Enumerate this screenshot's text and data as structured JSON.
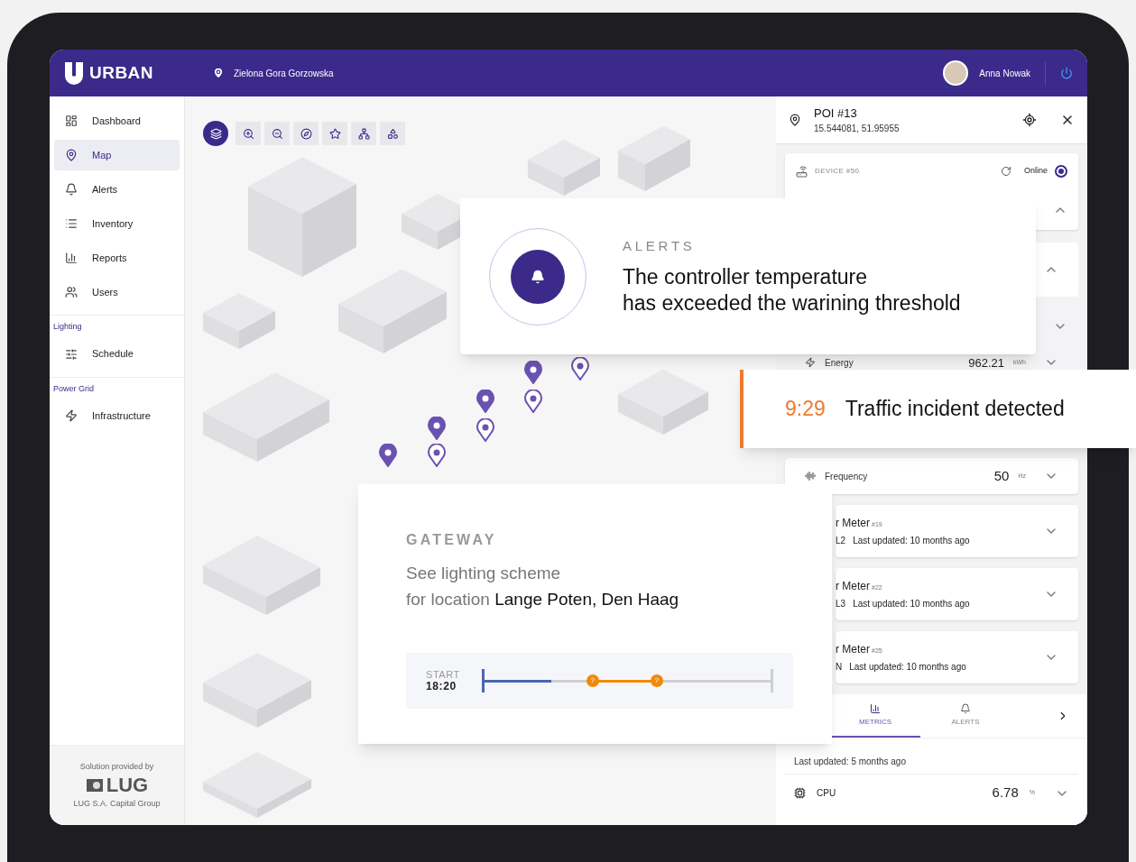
{
  "header": {
    "logo": "URBAN",
    "location": "Zielona Gora Gorzowska",
    "user": "Anna Nowak"
  },
  "sidebar": {
    "items": [
      {
        "label": "Dashboard",
        "selected": false
      },
      {
        "label": "Map",
        "selected": true
      },
      {
        "label": "Alerts",
        "selected": false
      },
      {
        "label": "Inventory",
        "selected": false
      },
      {
        "label": "Reports",
        "selected": false
      },
      {
        "label": "Users",
        "selected": false
      }
    ],
    "sections": [
      {
        "title": "Lighting",
        "items": [
          {
            "label": "Schedule",
            "selected": false
          }
        ]
      },
      {
        "title": "Power Grid",
        "items": [
          {
            "label": "Infrastructure",
            "selected": false
          }
        ]
      }
    ],
    "footer": {
      "caption": "Solution provided by",
      "logo": "LUG",
      "company": "LUG S.A. Capital Group"
    }
  },
  "map": {
    "tools": [
      {
        "selected": true
      },
      {
        "selected": false
      },
      {
        "selected": false
      },
      {
        "selected": false
      },
      {
        "selected": false
      },
      {
        "selected": false
      },
      {
        "selected": false
      }
    ]
  },
  "panel": {
    "poi": {
      "title": "POI #13",
      "coordinates": "15.544081, 51.95955"
    },
    "device": {
      "label": "DEVICE #50",
      "status": "Online",
      "online": true
    },
    "hidden_rows": [
      {
        "expanded": true
      },
      {
        "expanded": true
      },
      {
        "expanded": false
      }
    ],
    "energy": {
      "label": "Energy",
      "value": "962.21",
      "unit": "kWh",
      "expanded": false
    },
    "frequency": {
      "label": "Frequency",
      "value": "50",
      "unit": "Hz",
      "expanded": false
    },
    "meters": [
      {
        "name": "r Meter",
        "number": "#19",
        "phase": "L2",
        "updated": "Last updated: 10 months ago",
        "expanded": false
      },
      {
        "name": "r Meter",
        "number": "#22",
        "phase": "L3",
        "updated": "Last updated: 10 months ago",
        "expanded": false
      },
      {
        "name": "r Meter",
        "number": "#25",
        "phase": "N",
        "updated": "Last updated: 10 months ago",
        "expanded": false
      }
    ],
    "tabs": [
      {
        "label": "METRICS",
        "selected": true
      },
      {
        "label": "ALERTS",
        "selected": false
      }
    ],
    "last_updated": "Last updated: 5 months ago",
    "cpu": {
      "label": "CPU",
      "value": "6.78",
      "unit": "%",
      "expanded": false
    }
  },
  "alert_card": {
    "title": "ALERTS",
    "message_lines": [
      "The controller temperature",
      "has exceeded the warining threshold"
    ]
  },
  "traffic_card": {
    "time": "9:29",
    "message": "Traffic incident detected"
  },
  "gateway_card": {
    "title": "GATEWAY",
    "line1": "See lighting scheme",
    "prefix": "for location",
    "location": "Lange Poten, Den Haag",
    "start_label": "START",
    "start_time": "18:20",
    "level": 0.24,
    "markers": [
      {
        "label": "?"
      },
      {
        "label": "?"
      }
    ]
  }
}
